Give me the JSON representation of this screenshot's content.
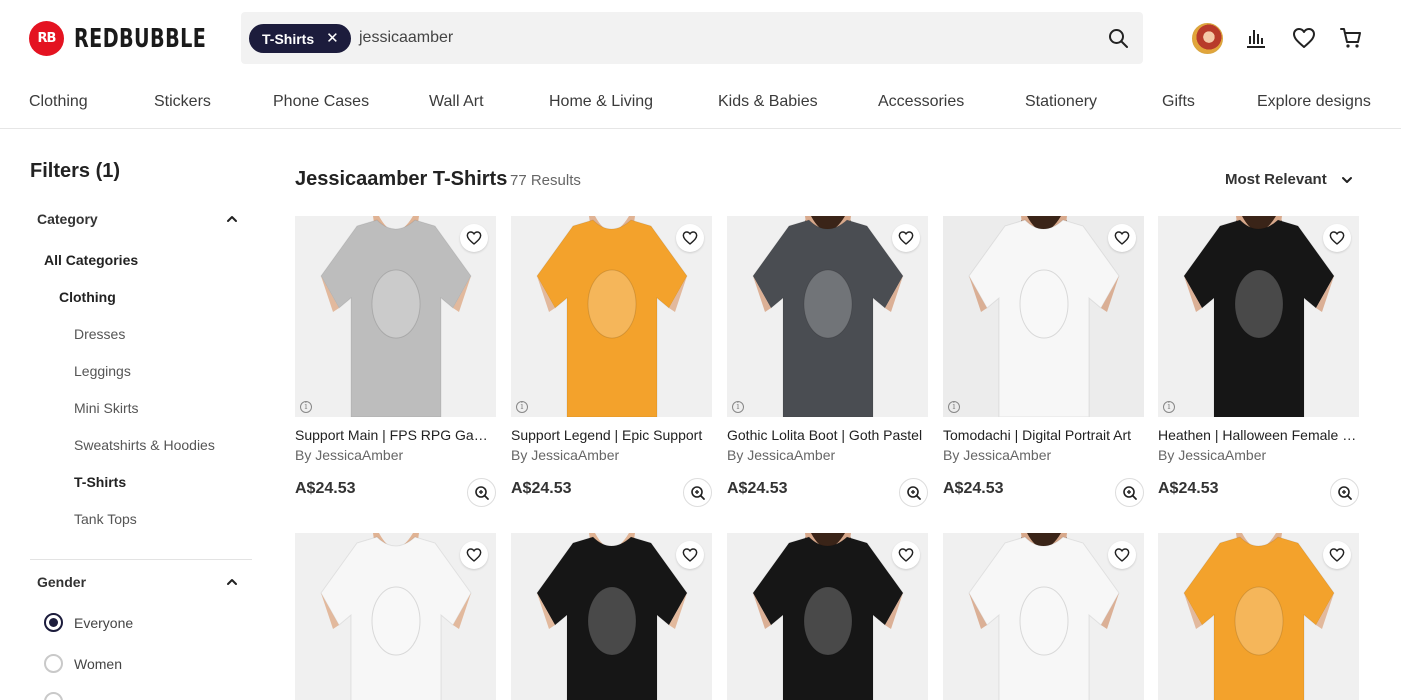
{
  "brand": {
    "name": "REDBUBBLE",
    "accent": "#e41321",
    "navy": "#1c1c3c"
  },
  "search": {
    "chip_label": "T-Shirts",
    "chip_close": "✕",
    "query": "jessicaamber"
  },
  "nav": [
    "Clothing",
    "Stickers",
    "Phone Cases",
    "Wall Art",
    "Home & Living",
    "Kids & Babies",
    "Accessories",
    "Stationery",
    "Gifts",
    "Explore designs"
  ],
  "filters": {
    "title": "Filters (1)",
    "category_label": "Category",
    "categories": [
      {
        "label": "All Categories",
        "bold": true
      },
      {
        "label": "Clothing",
        "bold": true
      },
      {
        "label": "Dresses",
        "bold": false
      },
      {
        "label": "Leggings",
        "bold": false
      },
      {
        "label": "Mini Skirts",
        "bold": false
      },
      {
        "label": "Sweatshirts & Hoodies",
        "bold": false
      },
      {
        "label": "T-Shirts",
        "bold": true
      },
      {
        "label": "Tank Tops",
        "bold": false
      }
    ],
    "gender_label": "Gender",
    "genders": [
      {
        "label": "Everyone",
        "selected": true
      },
      {
        "label": "Women",
        "selected": false
      }
    ]
  },
  "results": {
    "title": "Jessicaamber T-Shirts",
    "count": "77 Results",
    "sort": "Most Relevant"
  },
  "products": [
    {
      "title": "Support Main | FPS RPG Gamer",
      "artist": "By JessicaAmber",
      "price": "A$24.53",
      "shirt_color": "#bdbdbd",
      "bg": "#f0f0f0",
      "model": "man"
    },
    {
      "title": "Support Legend | Epic Support",
      "artist": "By JessicaAmber",
      "price": "A$24.53",
      "shirt_color": "#f3a22c",
      "bg": "#f0f0f0",
      "model": "man"
    },
    {
      "title": "Gothic Lolita Boot | Goth Pastel",
      "artist": "By JessicaAmber",
      "price": "A$24.53",
      "shirt_color": "#4a4d52",
      "bg": "#f0f0f0",
      "model": "woman"
    },
    {
      "title": "Tomodachi | Digital Portrait Art",
      "artist": "By JessicaAmber",
      "price": "A$24.53",
      "shirt_color": "#f7f7f7",
      "bg": "#ececec",
      "model": "woman"
    },
    {
      "title": "Heathen | Halloween Female Witch",
      "artist": "By JessicaAmber",
      "price": "A$24.53",
      "shirt_color": "#161616",
      "bg": "#f0f0f0",
      "model": "woman"
    },
    {
      "title": "",
      "artist": "",
      "price": "",
      "shirt_color": "#f7f7f7",
      "bg": "#f0f0f0",
      "model": "man"
    },
    {
      "title": "",
      "artist": "",
      "price": "",
      "shirt_color": "#161616",
      "bg": "#f0f0f0",
      "model": "man"
    },
    {
      "title": "",
      "artist": "",
      "price": "",
      "shirt_color": "#161616",
      "bg": "#f0f0f0",
      "model": "woman"
    },
    {
      "title": "",
      "artist": "",
      "price": "",
      "shirt_color": "#f7f7f7",
      "bg": "#f0f0f0",
      "model": "woman"
    },
    {
      "title": "",
      "artist": "",
      "price": "",
      "shirt_color": "#f3a22c",
      "bg": "#f0f0f0",
      "model": "man"
    }
  ]
}
